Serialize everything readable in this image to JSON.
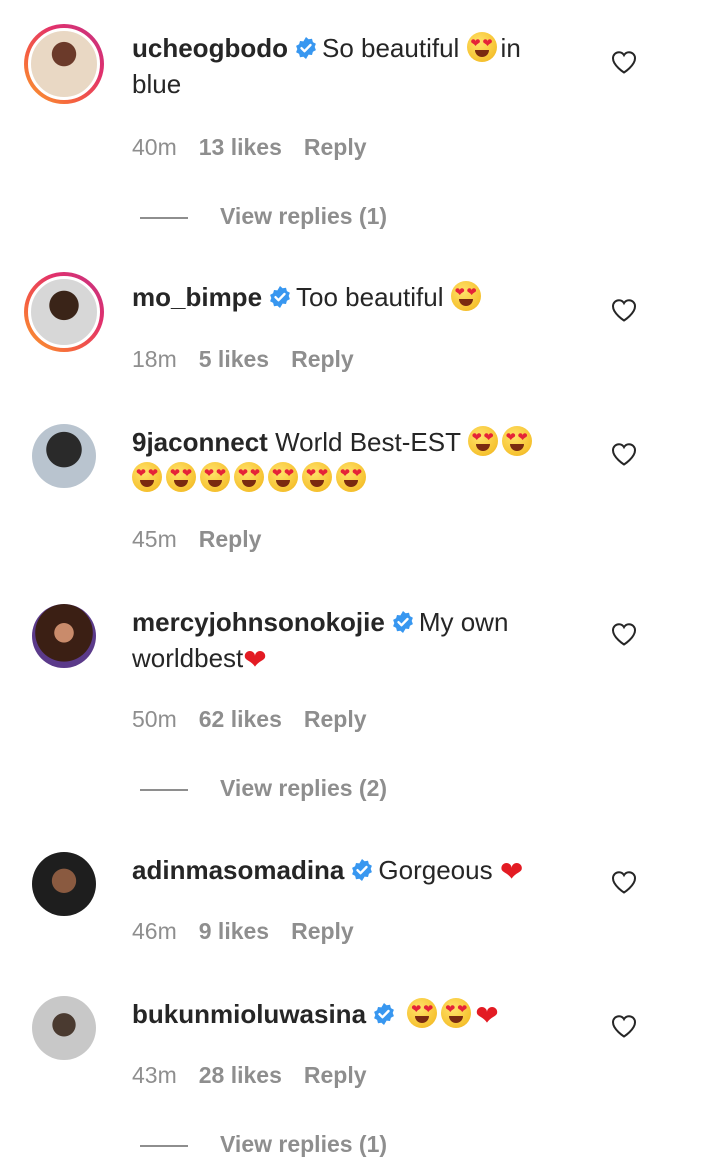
{
  "colors": {
    "verified": "#3897f0",
    "meta_text": "#8e8e8e",
    "primary_text": "#262626"
  },
  "comments": [
    {
      "user": "ucheogbodo",
      "text_a": "So beautiful ",
      "text_b": "in blue",
      "time": "40m",
      "likes": "13 likes",
      "reply": "Reply",
      "view_replies": "View replies (1)"
    },
    {
      "user": "mo_bimpe",
      "text_a": "Too beautiful ",
      "time": "18m",
      "likes": "5 likes",
      "reply": "Reply"
    },
    {
      "user": "9jaconnect",
      "text_a": "World Best-EST ",
      "time": "45m",
      "reply": "Reply"
    },
    {
      "user": "mercyjohnsonokojie",
      "text_a": "My own worldbest",
      "time": "50m",
      "likes": "62 likes",
      "reply": "Reply",
      "view_replies": "View replies (2)"
    },
    {
      "user": "adinmasomadina",
      "text_a": "Gorgeous ",
      "time": "46m",
      "likes": "9 likes",
      "reply": "Reply"
    },
    {
      "user": "bukunmioluwasina",
      "time": "43m",
      "likes": "28 likes",
      "reply": "Reply",
      "view_replies": "View replies (1)"
    }
  ]
}
